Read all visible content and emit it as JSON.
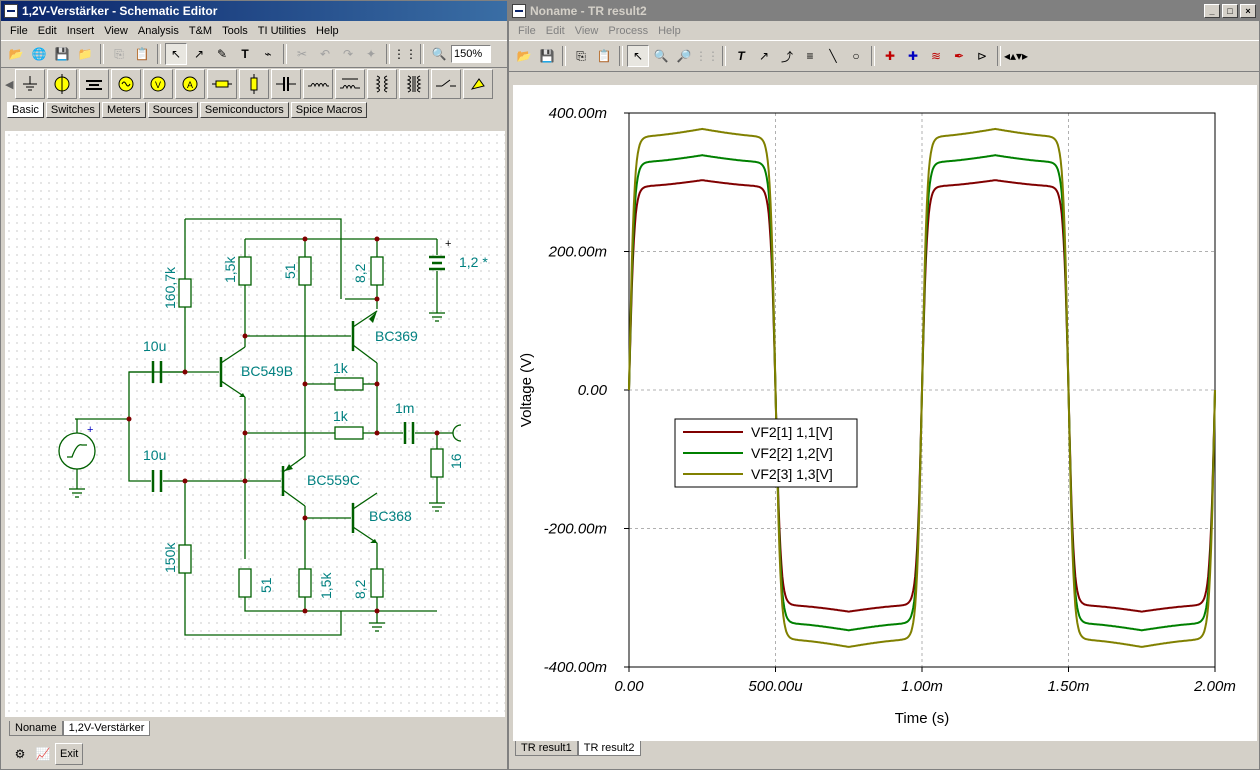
{
  "schematic": {
    "title": "1,2V-Verstärker - Schematic Editor",
    "menu": [
      "File",
      "Edit",
      "Insert",
      "View",
      "Analysis",
      "T&M",
      "Tools",
      "TI Utilities",
      "Help"
    ],
    "zoom": "150%",
    "tabs": [
      "Basic",
      "Switches",
      "Meters",
      "Sources",
      "Semiconductors",
      "Spice Macros"
    ],
    "bottom_tabs": [
      "Noname",
      "1,2V-Verstärker"
    ],
    "exit_label": "Exit",
    "labels": {
      "r1": "160,7k",
      "r2": "1,5k",
      "r3": "51",
      "r4": "8,2",
      "battery": "1,2 *",
      "q1": "BC549B",
      "q2": "BC369",
      "r5": "1k",
      "r6": "1k",
      "c3": "1m",
      "rl": "16",
      "c1": "10u",
      "c2": "10u",
      "q3": "BC559C",
      "q4": "BC368",
      "r7": "150k",
      "r8": "51",
      "r9": "1,5k",
      "r10": "8,2"
    }
  },
  "result": {
    "title": "Noname - TR result2",
    "menu": [
      "File",
      "Edit",
      "View",
      "Process",
      "Help"
    ],
    "bottom_tabs": [
      "TR result1",
      "TR result2"
    ]
  },
  "chart_data": {
    "type": "line",
    "xlabel": "Time (s)",
    "ylabel": "Voltage (V)",
    "xlim": [
      0,
      0.002
    ],
    "ylim": [
      -0.4,
      0.4
    ],
    "xticks": [
      {
        "v": 0,
        "label": "0.00"
      },
      {
        "v": 0.0005,
        "label": "500.00u"
      },
      {
        "v": 0.001,
        "label": "1.00m"
      },
      {
        "v": 0.0015,
        "label": "1.50m"
      },
      {
        "v": 0.002,
        "label": "2.00m"
      }
    ],
    "yticks": [
      {
        "v": 0.4,
        "label": "400.00m"
      },
      {
        "v": 0.2,
        "label": "200.00m"
      },
      {
        "v": 0,
        "label": "0.00"
      },
      {
        "v": -0.2,
        "label": "-200.00m"
      },
      {
        "v": -0.4,
        "label": "-400.00m"
      }
    ],
    "grid": true,
    "legend_position": "center-left",
    "series": [
      {
        "name": "VF2[1]  1,1[V]",
        "color": "#800000",
        "amplitude": 0.303,
        "neg_amplitude": 0.32
      },
      {
        "name": "VF2[2]  1,2[V]",
        "color": "#008000",
        "amplitude": 0.339,
        "neg_amplitude": 0.347
      },
      {
        "name": "VF2[3]  1,3[V]",
        "color": "#808000",
        "amplitude": 0.377,
        "neg_amplitude": 0.371
      }
    ],
    "period": 0.001
  },
  "colors": {
    "wire": "#006000",
    "label": "#008080",
    "node": "#800000"
  }
}
